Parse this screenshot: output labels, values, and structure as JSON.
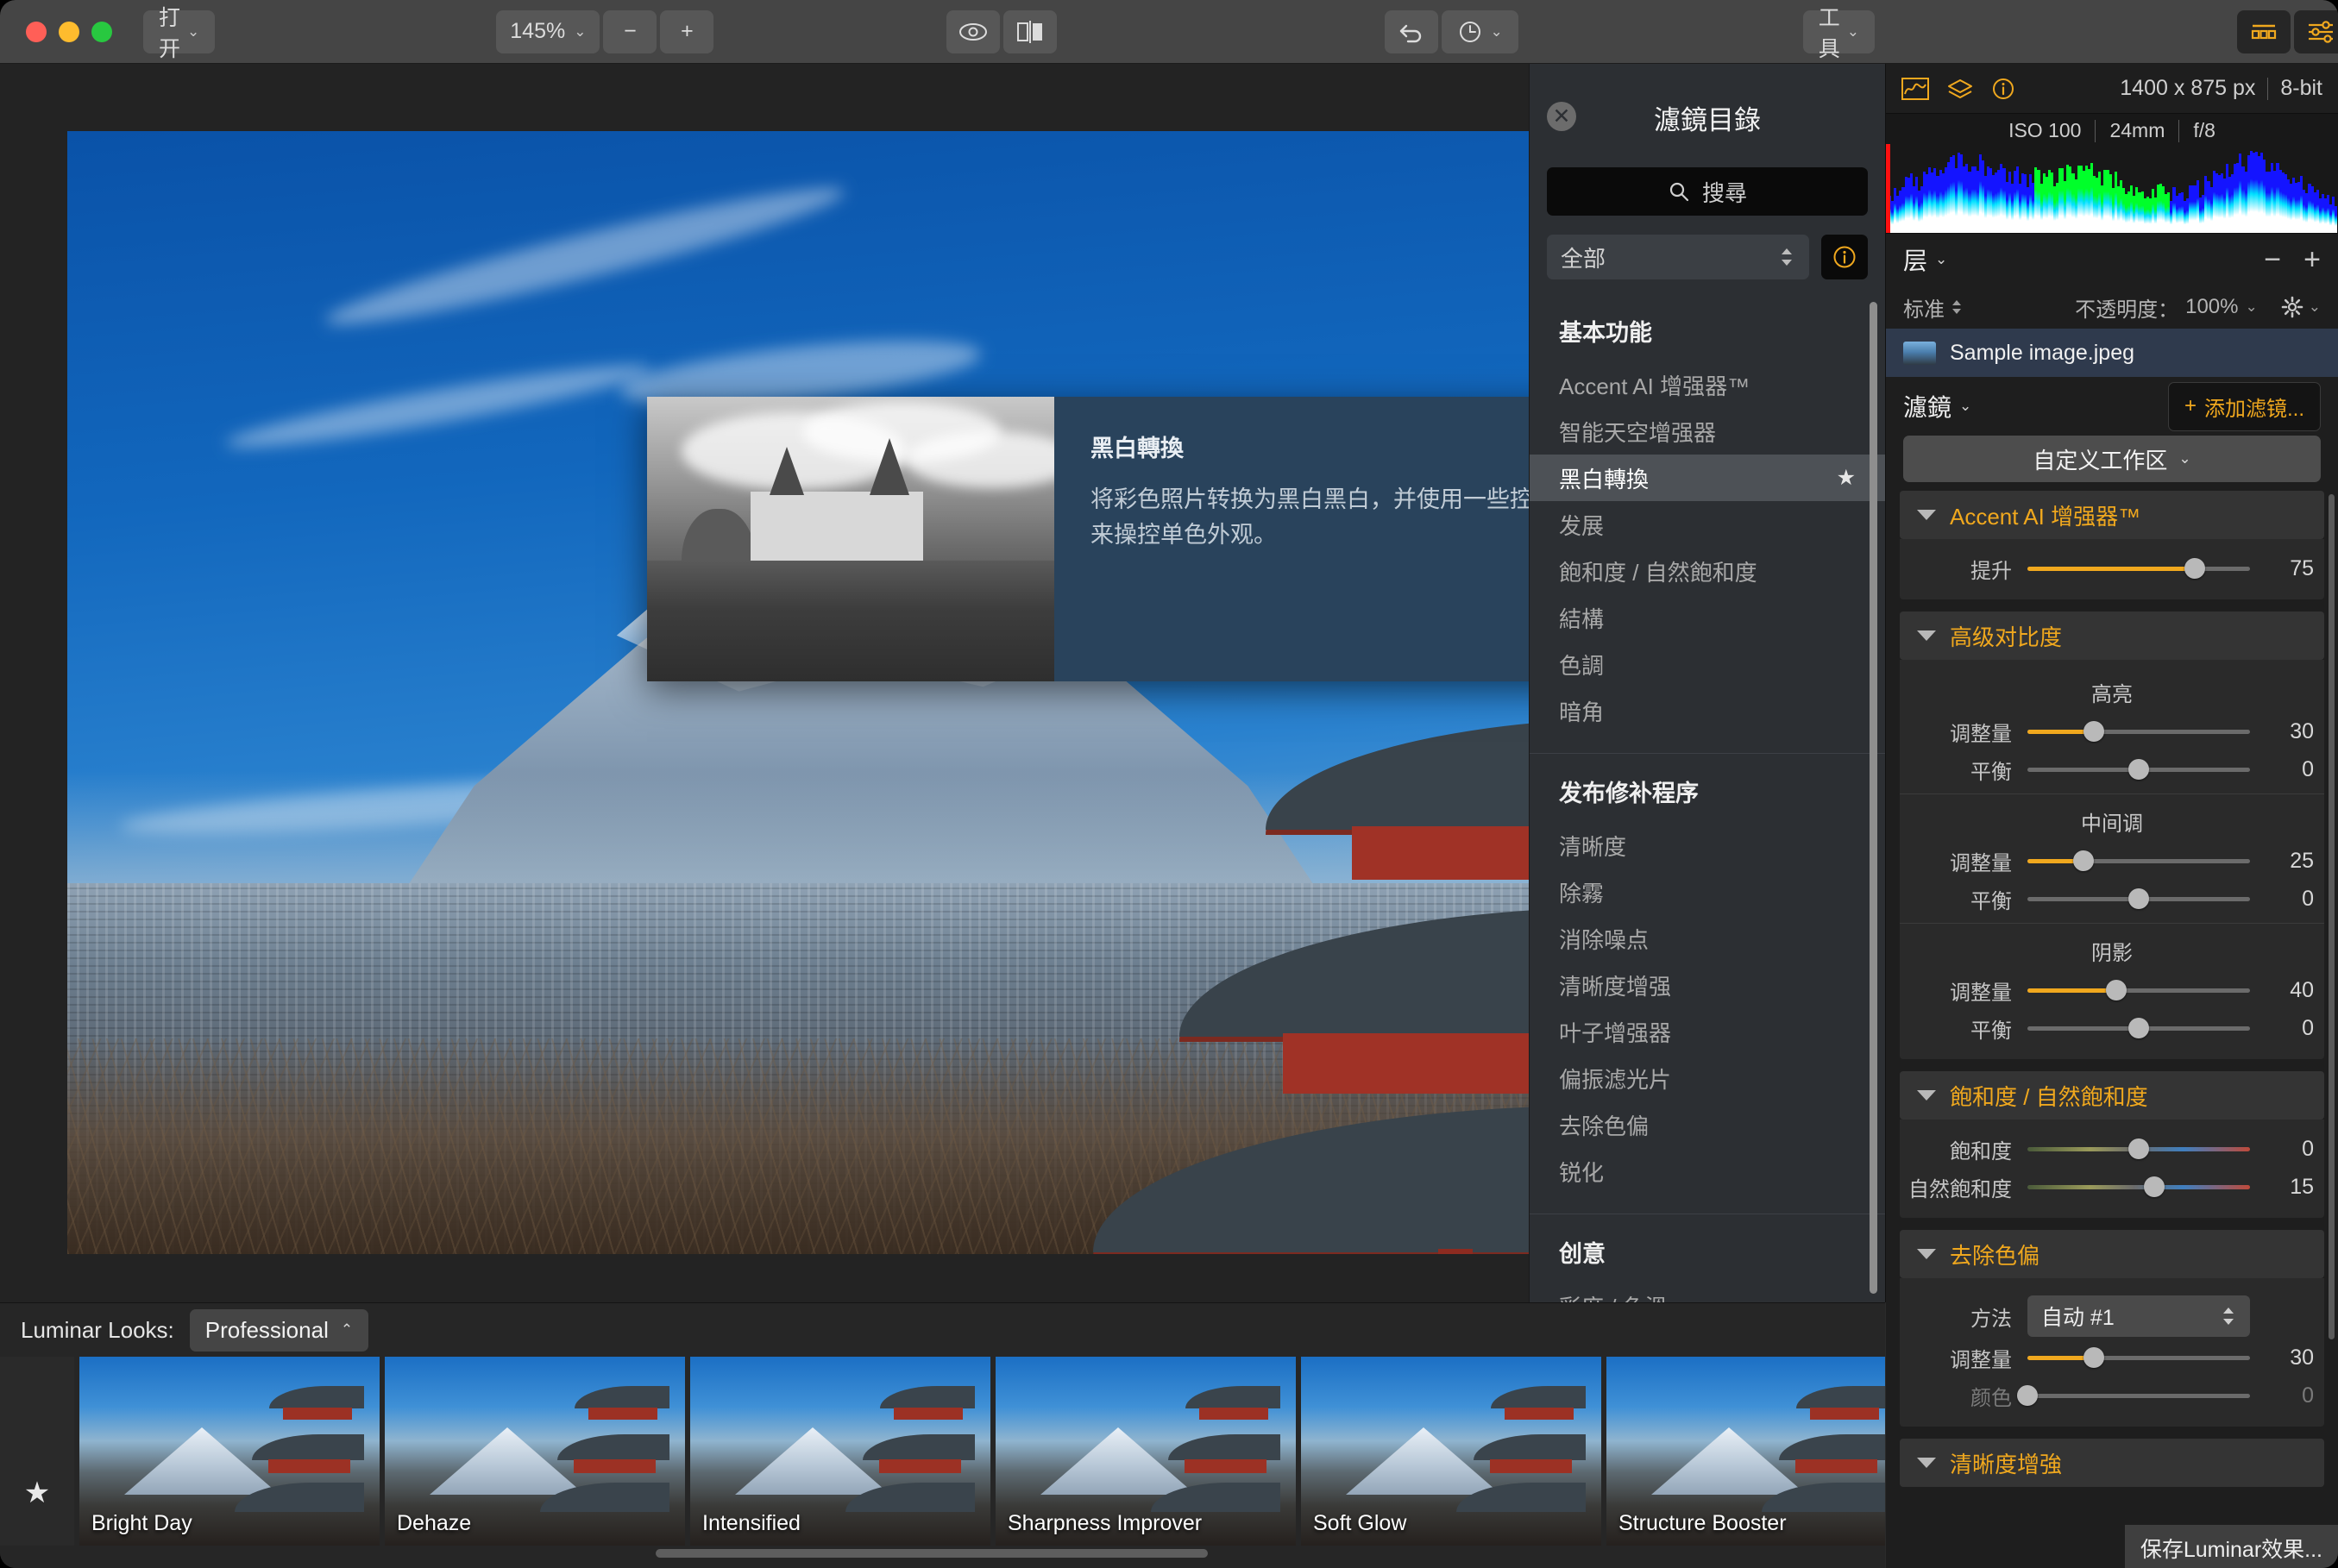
{
  "toolbar": {
    "open_label": "打开",
    "zoom_value": "145%",
    "zoom_out": "−",
    "zoom_in": "+",
    "preview_icon": "eye-icon",
    "compare_icon": "split-view-icon",
    "undo_icon": "undo-arrow-icon",
    "history_icon": "history-clock-icon",
    "tools_label": "工具",
    "looks_panel_icon": "looks-panel-icon",
    "edit_panel_icon": "edit-sliders-icon",
    "share_icon": "share-upload-icon"
  },
  "tooltip": {
    "title": "黑白轉換",
    "description": "将彩色照片转换为黑白黑白，并使用一些控件来操控单色外观。"
  },
  "catalog": {
    "title": "濾鏡目錄",
    "close_icon": "close-icon",
    "search_placeholder": "搜尋",
    "search_icon": "search-icon",
    "category_selected": "全部",
    "info_icon": "info-icon",
    "groups": [
      {
        "title": "基本功能",
        "items": [
          {
            "label": "Accent AI 增强器™",
            "active": false,
            "starred": false
          },
          {
            "label": "智能天空增强器",
            "active": false,
            "starred": false
          },
          {
            "label": "黑白轉換",
            "active": true,
            "starred": true
          },
          {
            "label": "发展",
            "active": false,
            "starred": false
          },
          {
            "label": "飽和度 / 自然飽和度",
            "active": false,
            "starred": false
          },
          {
            "label": "結構",
            "active": false,
            "starred": false
          },
          {
            "label": "色調",
            "active": false,
            "starred": false
          },
          {
            "label": "暗角",
            "active": false,
            "starred": false
          }
        ]
      },
      {
        "title": "发布修补程序",
        "items": [
          {
            "label": "清晰度",
            "active": false,
            "starred": false
          },
          {
            "label": "除霧",
            "active": false,
            "starred": false
          },
          {
            "label": "消除噪点",
            "active": false,
            "starred": false
          },
          {
            "label": "清晰度增强",
            "active": false,
            "starred": false
          },
          {
            "label": "叶子增强器",
            "active": false,
            "starred": false
          },
          {
            "label": "偏振滤光片",
            "active": false,
            "starred": false
          },
          {
            "label": "去除色偏",
            "active": false,
            "starred": false
          },
          {
            "label": "锐化",
            "active": false,
            "starred": false
          }
        ]
      },
      {
        "title": "创意",
        "items": [
          {
            "label": "彩度 / 色溫",
            "active": false,
            "starred": false
          }
        ]
      }
    ]
  },
  "right_panel": {
    "histogram_icon": "histogram-icon",
    "layers_icon": "layers-icon",
    "info_icon": "info-icon",
    "dimensions": "1400 x 875 px",
    "bit_depth": "8-bit",
    "exif": {
      "iso": "ISO 100",
      "focal": "24mm",
      "aperture": "f/8"
    },
    "layers": {
      "title": "层",
      "remove_label": "−",
      "add_label": "+",
      "blend_mode": "标准",
      "opacity_label": "不透明度：",
      "opacity_value": "100%",
      "gear_icon": "gear-icon",
      "layer_name": "Sample image.jpeg"
    },
    "filters": {
      "title": "濾鏡",
      "add_label": "添加滤镜...",
      "workspace": "自定义工作区"
    },
    "sections": [
      {
        "name": "Accent AI 增强器™",
        "sliders": [
          {
            "label": "提升",
            "value": "75",
            "pct": 75,
            "grad": false,
            "dim": false
          }
        ]
      },
      {
        "name": "高级对比度",
        "subgroups": [
          {
            "label": "高亮",
            "sliders": [
              {
                "label": "调整量",
                "value": "30",
                "pct": 30,
                "grad": false,
                "dim": false
              },
              {
                "label": "平衡",
                "value": "0",
                "pct": 50,
                "grad": false,
                "dim": false,
                "nofill": true
              }
            ]
          },
          {
            "label": "中间调",
            "sliders": [
              {
                "label": "调整量",
                "value": "25",
                "pct": 25,
                "grad": false,
                "dim": false
              },
              {
                "label": "平衡",
                "value": "0",
                "pct": 50,
                "grad": false,
                "dim": false,
                "nofill": true
              }
            ]
          },
          {
            "label": "阴影",
            "sliders": [
              {
                "label": "调整量",
                "value": "40",
                "pct": 40,
                "grad": false,
                "dim": false
              },
              {
                "label": "平衡",
                "value": "0",
                "pct": 50,
                "grad": false,
                "dim": false,
                "nofill": true
              }
            ]
          }
        ]
      },
      {
        "name": "飽和度 / 自然飽和度",
        "sliders": [
          {
            "label": "飽和度",
            "value": "0",
            "pct": 50,
            "grad": true,
            "dim": false,
            "nofill": true
          },
          {
            "label": "自然飽和度",
            "value": "15",
            "pct": 57,
            "grad": true,
            "dim": false,
            "nofill": true
          }
        ]
      },
      {
        "name": "去除色偏",
        "method_label": "方法",
        "method_value": "自动 #1",
        "sliders": [
          {
            "label": "调整量",
            "value": "30",
            "pct": 30,
            "grad": false,
            "dim": false
          },
          {
            "label": "颜色",
            "value": "0",
            "pct": 0,
            "grad": false,
            "dim": true,
            "nofill": true
          }
        ]
      },
      {
        "name": "清晰度增強",
        "sliders": []
      }
    ],
    "save_label": "保存Luminar效果..."
  },
  "looks": {
    "label": "Luminar Looks:",
    "category": "Professional",
    "favorite_icon": "star-icon",
    "items": [
      {
        "name": "Bright Day"
      },
      {
        "name": "Dehaze"
      },
      {
        "name": "Intensified"
      },
      {
        "name": "Sharpness Improver"
      },
      {
        "name": "Soft Glow"
      },
      {
        "name": "Structure Booster"
      }
    ]
  },
  "colors": {
    "accent": "#f0a81e",
    "panel": "#1e1e1e",
    "toolbar": "#454545"
  }
}
